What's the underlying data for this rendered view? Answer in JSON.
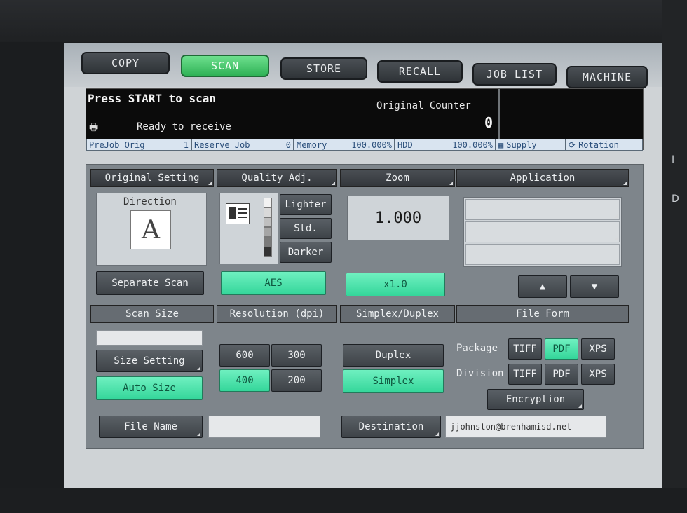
{
  "tabs": [
    {
      "label": "COPY",
      "active": false
    },
    {
      "label": "SCAN",
      "active": true
    },
    {
      "label": "STORE",
      "active": false
    },
    {
      "label": "RECALL",
      "active": false
    },
    {
      "label": "JOB LIST",
      "active": false
    },
    {
      "label": "MACHINE",
      "active": false
    }
  ],
  "status": {
    "message": "Press START to scan",
    "ready": "Ready to receive",
    "counter_label": "Original Counter",
    "counter_value": "0"
  },
  "statusbar": [
    {
      "label": "PreJob Orig",
      "value": "1"
    },
    {
      "label": "Reserve Job",
      "value": "0"
    },
    {
      "label": "Memory",
      "value": "100.000%"
    },
    {
      "label": "HDD",
      "value": "100.000%"
    },
    {
      "label": "Supply",
      "value": ""
    },
    {
      "label": "Rotation",
      "value": ""
    }
  ],
  "original_setting": {
    "header": "Original Setting",
    "direction_label": "Direction",
    "direction_letter": "A",
    "separate_scan": "Separate Scan"
  },
  "quality": {
    "header": "Quality Adj.",
    "lighter": "Lighter",
    "std": "Std.",
    "darker": "Darker",
    "aes": "AES"
  },
  "zoom": {
    "header": "Zoom",
    "value": "1.000",
    "x1": "x1.0"
  },
  "application": {
    "header": "Application",
    "up": "▲",
    "down": "▼"
  },
  "scan_size": {
    "header": "Scan Size",
    "size_setting": "Size Setting",
    "auto_size": "Auto Size"
  },
  "resolution": {
    "header": "Resolution (dpi)",
    "options": [
      "600",
      "300",
      "400",
      "200"
    ],
    "selected": "400"
  },
  "duplex": {
    "header": "Simplex/Duplex",
    "duplex": "Duplex",
    "simplex": "Simplex"
  },
  "file_form": {
    "header": "File Form",
    "package_label": "Package",
    "division_label": "Division",
    "tiff": "TIFF",
    "pdf": "PDF",
    "xps": "XPS",
    "encryption": "Encryption"
  },
  "bottom": {
    "file_name": "File Name",
    "file_name_value": "",
    "destination": "Destination",
    "destination_value": "jjohnston@brenhamisd.net"
  },
  "side_labels": [
    "I",
    "D"
  ],
  "colors": {
    "active_green": "#34d69a",
    "tab_active": "#2fb256",
    "panel_gray": "#7e858b"
  }
}
